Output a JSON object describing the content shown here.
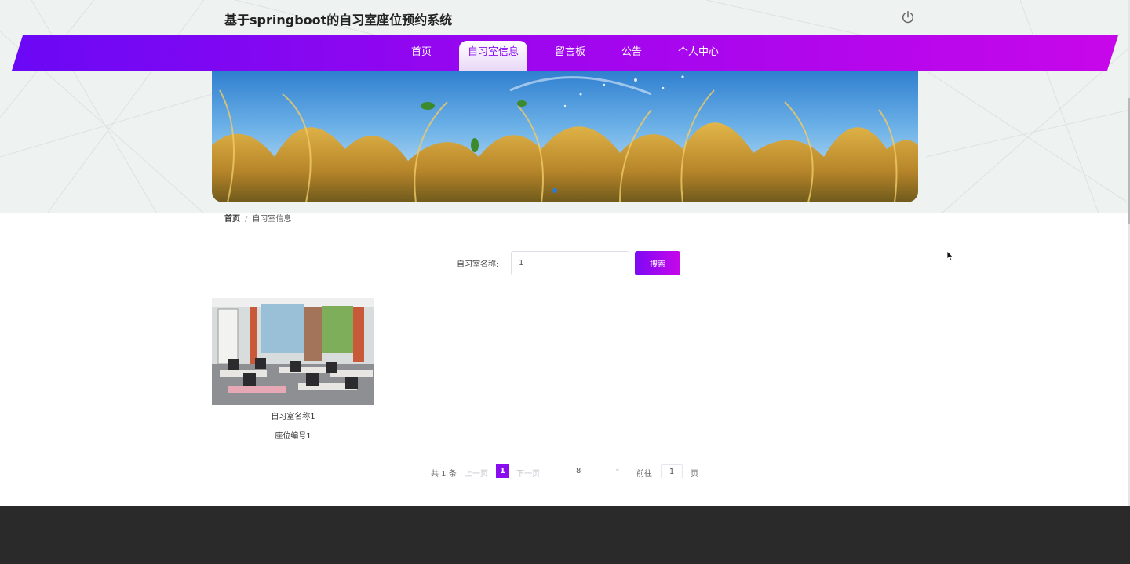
{
  "header": {
    "title": "基于springboot的自习室座位预约系统",
    "logout_icon": "power-icon"
  },
  "nav": {
    "items": [
      {
        "label": "首页",
        "active": false
      },
      {
        "label": "自习室信息",
        "active": true
      },
      {
        "label": "留言板",
        "active": false
      },
      {
        "label": "公告",
        "active": false
      },
      {
        "label": "个人中心",
        "active": false
      }
    ]
  },
  "breadcrumb": {
    "home": "首页",
    "separator": "/",
    "current": "自习室信息"
  },
  "search": {
    "label": "自习室名称:",
    "value": "1",
    "button_label": "搜索"
  },
  "cards": [
    {
      "name": "自习室名称1",
      "seat": "座位编号1"
    }
  ],
  "pagination": {
    "total_text": "共 1 条",
    "prev_label": "上一页",
    "current_page": "1",
    "next_label": "下一页",
    "page_size": "8",
    "goto_label": "前往",
    "goto_value": "1",
    "page_unit": "页"
  },
  "colors": {
    "accent": "#8a0df0",
    "nav_gradient_start": "#6a08f5",
    "nav_gradient_end": "#c707ea",
    "footer": "#2a2a2a"
  }
}
